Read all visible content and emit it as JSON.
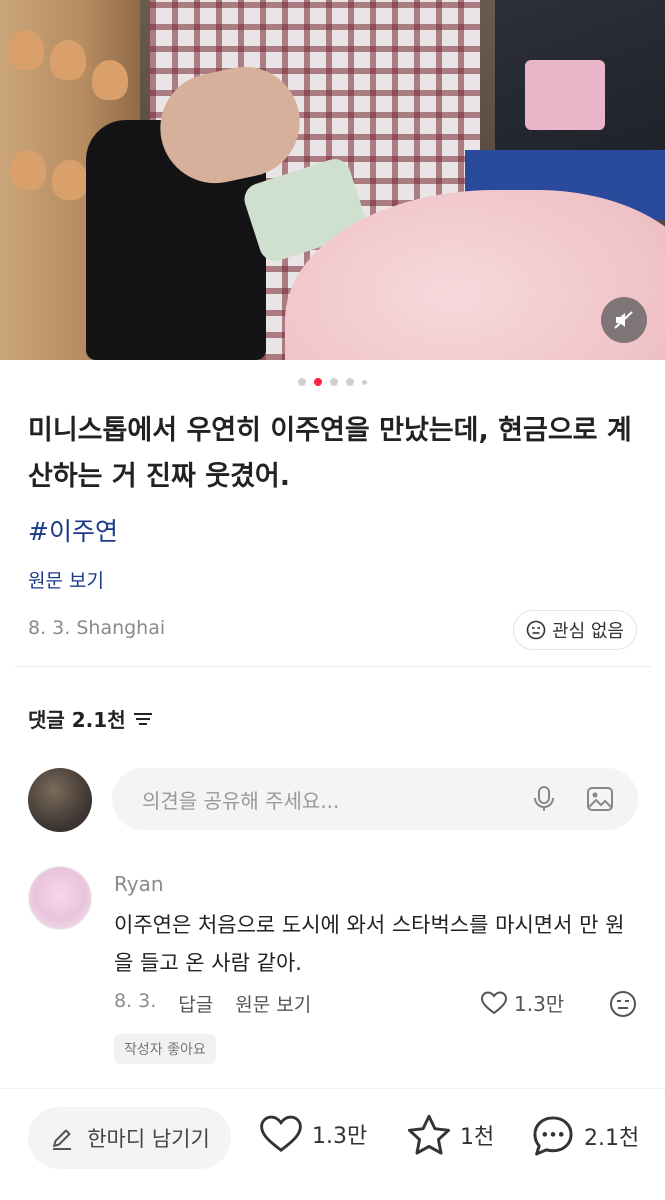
{
  "post": {
    "title": "미니스톱에서 우연히 이주연을 만났는데, 현금으로 계산하는 거 진짜 웃겼어.",
    "hashtag": "#이주연",
    "view_original": "원문 보기",
    "date_location": "8. 3. Shanghai",
    "not_interested": "관심 없음",
    "carousel": {
      "total": 5,
      "active_index": 1
    }
  },
  "comments": {
    "header": "댓글 2.1천",
    "input_placeholder": "의견을 공유해 주세요...",
    "items": [
      {
        "author": "Ryan",
        "body": "이주연은 처음으로 도시에 와서 스타벅스를 마시면서 만 원을 들고 온 사람 같아.",
        "date": "8. 3.",
        "reply_label": "답글",
        "original_label": "원문 보기",
        "likes": "1.3만",
        "author_liked_badge": "작성자 좋아요"
      }
    ]
  },
  "bottom_bar": {
    "leave_comment": "한마디 남기기",
    "likes": "1.3만",
    "favorites": "1천",
    "comments": "2.1천"
  },
  "colors": {
    "accent_red": "#ff2442",
    "link_blue": "#1b3a8a"
  }
}
